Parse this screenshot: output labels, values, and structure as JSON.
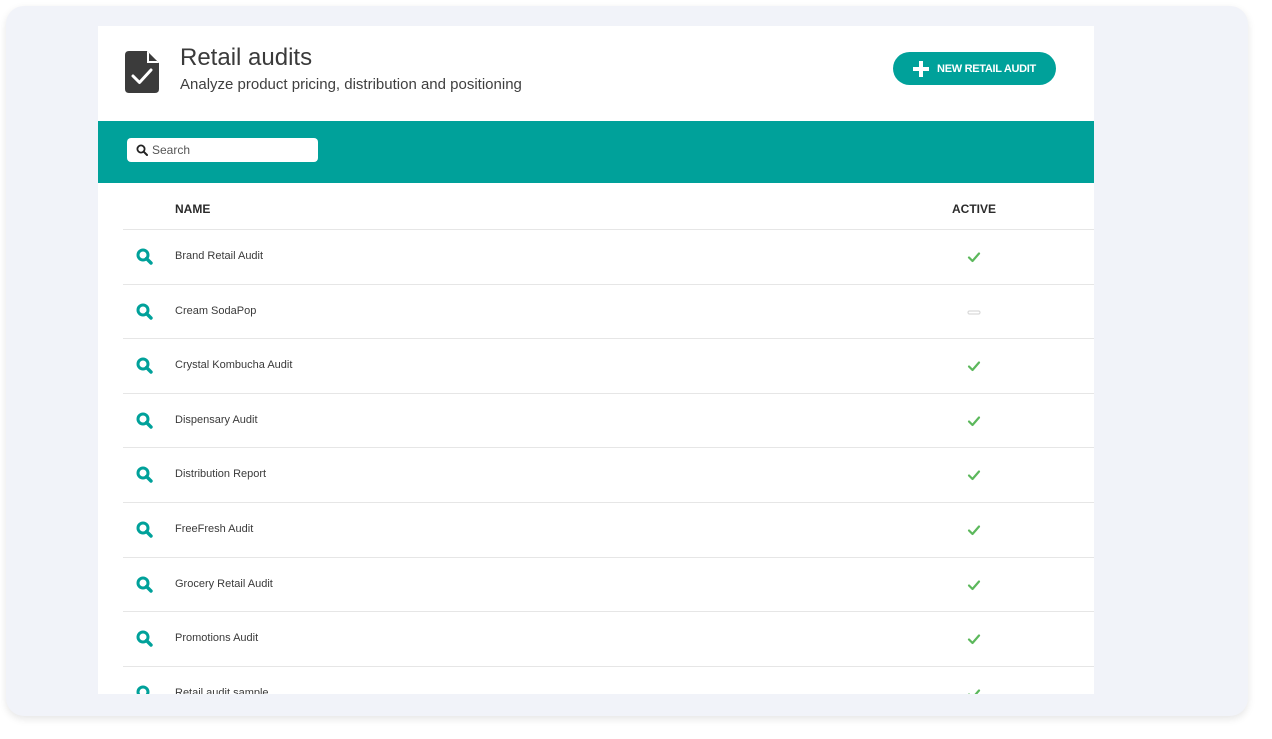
{
  "header": {
    "title": "Retail audits",
    "subtitle": "Analyze product pricing, distribution and positioning",
    "icon": "document-check-icon",
    "new_button_label": "NEW RETAIL AUDIT"
  },
  "search": {
    "placeholder": "Search",
    "value": ""
  },
  "table": {
    "columns": [
      "NAME",
      "ACTIVE"
    ],
    "rows": [
      {
        "name": "Brand Retail Audit",
        "active": true
      },
      {
        "name": "Cream SodaPop",
        "active": false
      },
      {
        "name": "Crystal Kombucha Audit",
        "active": true
      },
      {
        "name": "Dispensary Audit",
        "active": true
      },
      {
        "name": "Distribution Report",
        "active": true
      },
      {
        "name": "FreeFresh Audit",
        "active": true
      },
      {
        "name": "Grocery Retail Audit",
        "active": true
      },
      {
        "name": "Promotions Audit",
        "active": true
      },
      {
        "name": "Retail audit sample",
        "active": true
      }
    ]
  },
  "colors": {
    "accent": "#00a19a",
    "check": "#5cb85c",
    "inactive": "#d9d9d9",
    "icon_dark": "#3b3b3b"
  }
}
